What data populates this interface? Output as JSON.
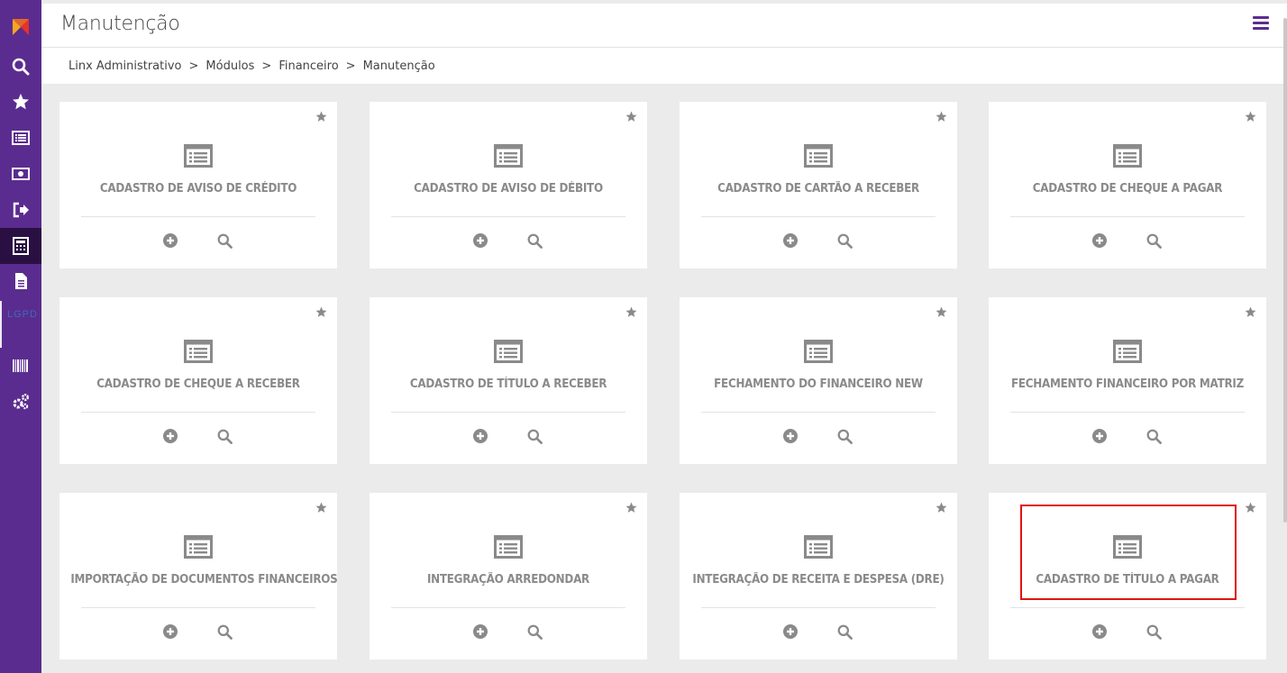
{
  "header": {
    "title": "Manutenção"
  },
  "breadcrumb": {
    "items": [
      "Linx Administrativo",
      "Módulos",
      "Financeiro",
      "Manutenção"
    ],
    "separator": ">"
  },
  "sidebar": {
    "icons": [
      "logo-icon",
      "search-icon",
      "star-icon",
      "list-icon",
      "money-icon",
      "exit-icon",
      "calculator-icon",
      "document-icon",
      "barcode-icon",
      "settings-icon"
    ],
    "ghost_text": "LGPD",
    "active_index": 6
  },
  "cards": [
    {
      "title": "CADASTRO DE AVISO DE CRÉDITO"
    },
    {
      "title": "CADASTRO DE AVISO DE DÉBITO"
    },
    {
      "title": "CADASTRO DE CARTÃO A RECEBER"
    },
    {
      "title": "CADASTRO DE CHEQUE A PAGAR"
    },
    {
      "title": "CADASTRO DE CHEQUE A RECEBER"
    },
    {
      "title": "CADASTRO DE TÍTULO A RECEBER"
    },
    {
      "title": "FECHAMENTO DO FINANCEIRO NEW"
    },
    {
      "title": "FECHAMENTO FINANCEIRO POR MATRIZ"
    },
    {
      "title": "IMPORTAÇÃO DE DOCUMENTOS FINANCEIROS"
    },
    {
      "title": "INTEGRAÇÃO ARREDONDAR"
    },
    {
      "title": "INTEGRAÇÃO DE RECEITA E DESPESA (DRE)"
    },
    {
      "title": "CADASTRO DE TÍTULO A PAGAR"
    }
  ],
  "colors": {
    "sidebar": "#5b2c8f",
    "sidebar_active": "#2a1042",
    "accent": "#5b2c8f",
    "highlight": "#e01313",
    "card_text": "#8a8a8a",
    "background": "#ebebeb"
  }
}
